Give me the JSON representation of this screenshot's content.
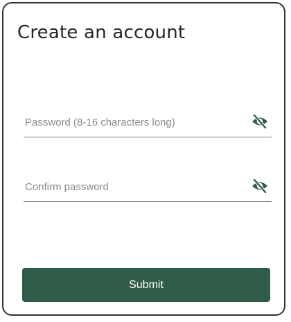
{
  "form": {
    "title": "Create an account",
    "password": {
      "placeholder": "Password (8-16 characters long)",
      "value": "",
      "visibility_icon": "eye-off-icon"
    },
    "confirm_password": {
      "placeholder": "Confirm password",
      "value": "",
      "visibility_icon": "eye-off-icon"
    },
    "submit_label": "Submit"
  },
  "colors": {
    "accent": "#2f5c49",
    "title_text": "#262626",
    "placeholder_text": "#8a8a8a",
    "underline": "#7a7a7a",
    "border": "#333333"
  }
}
